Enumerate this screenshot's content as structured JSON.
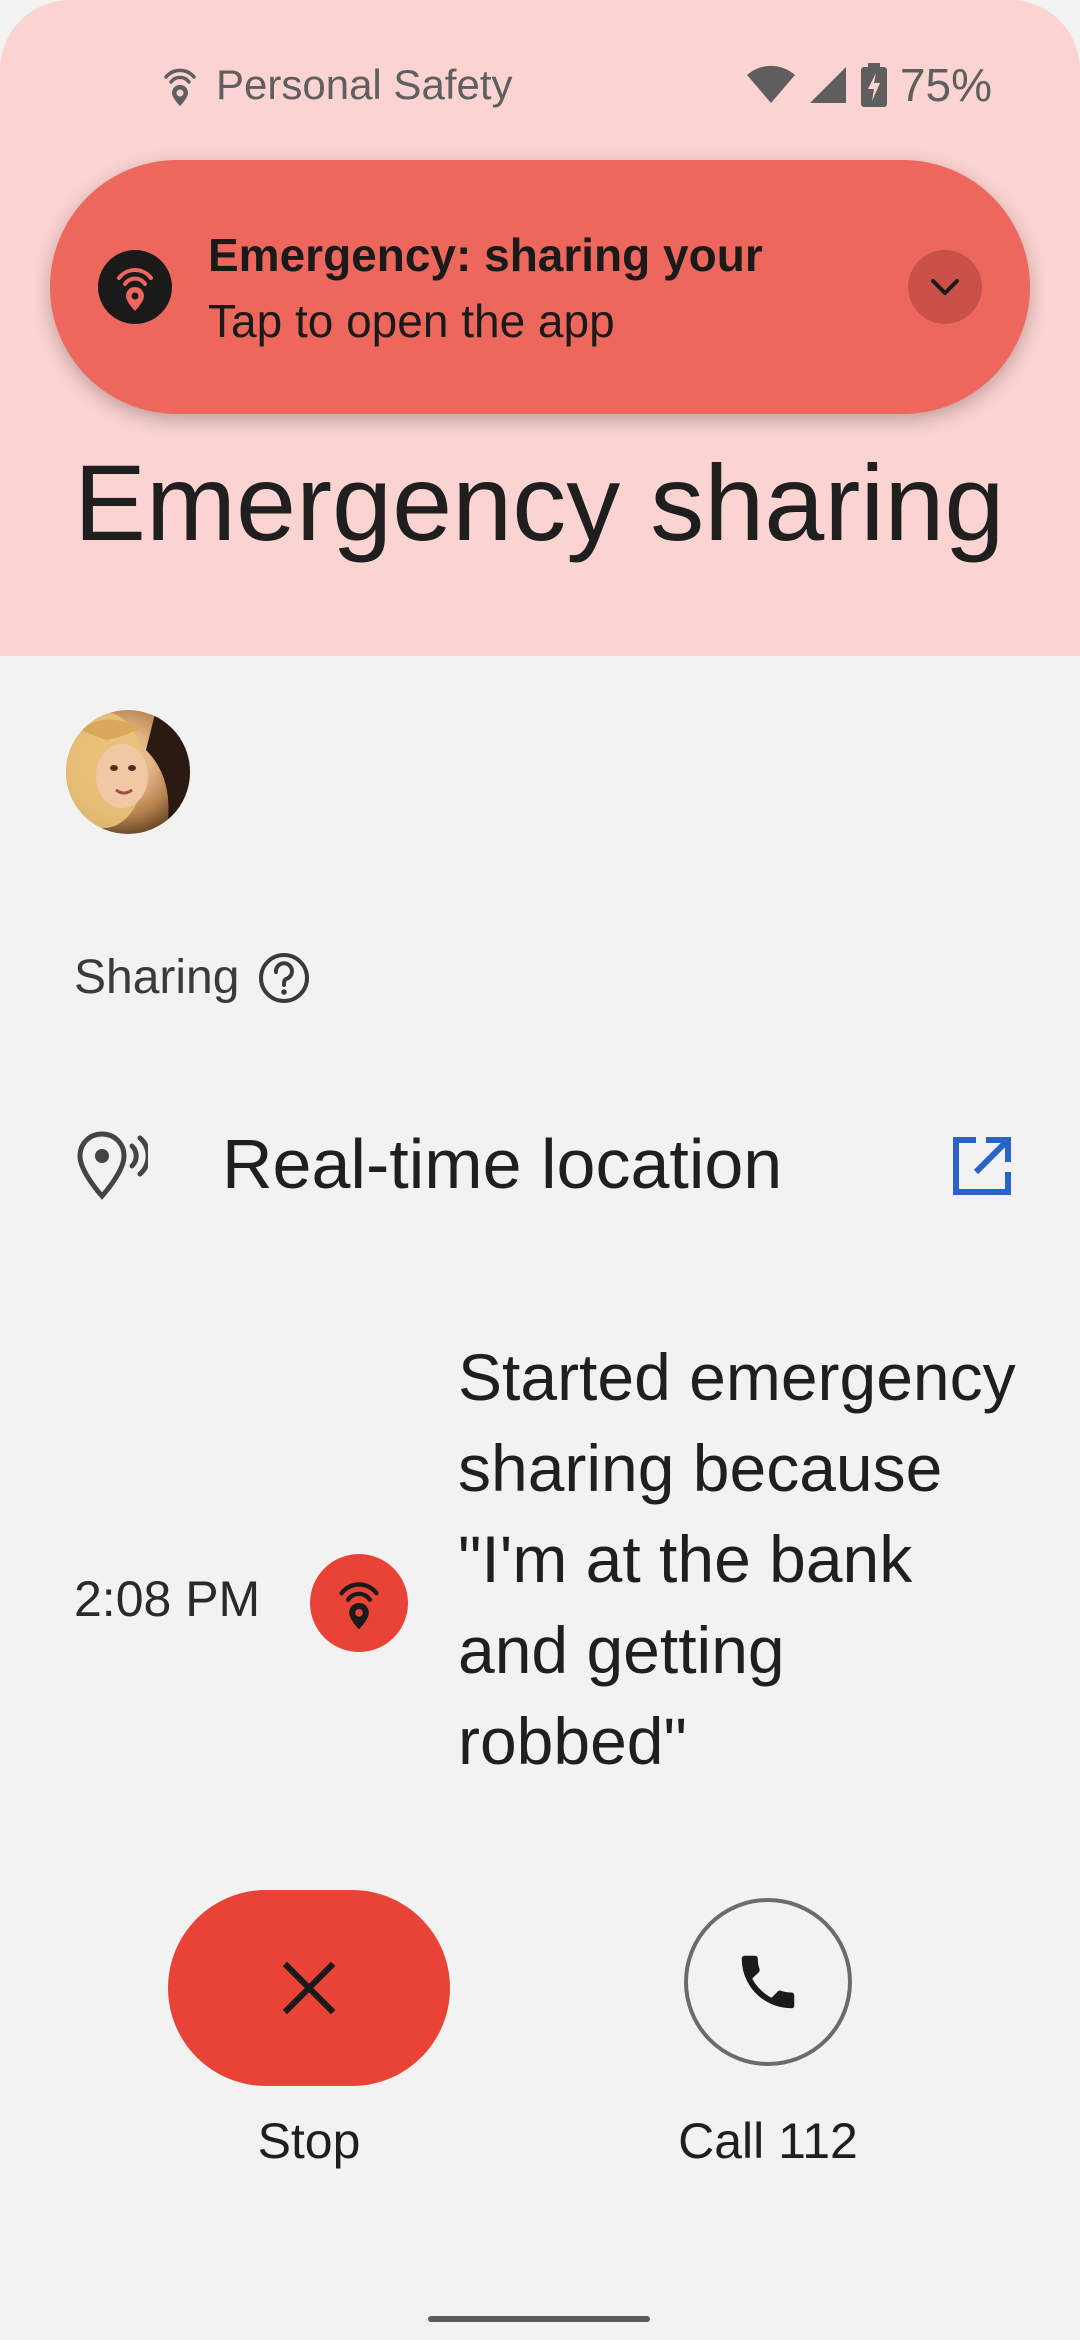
{
  "status_bar": {
    "app_name": "Personal Safety",
    "battery": "75%",
    "icons": [
      "personal-safety-icon",
      "wifi-icon",
      "signal-icon",
      "battery-charging-icon"
    ]
  },
  "notification": {
    "title": "Emergency: sharing your",
    "subtitle": "Tap to open the app",
    "icon": "emergency-sharing-icon",
    "expand_icon": "chevron-down-icon",
    "background": "#ed675c"
  },
  "header": {
    "title": "Emergency sharing",
    "background": "#fbd3d1"
  },
  "sharing": {
    "label": "Sharing",
    "help_icon": "help-icon"
  },
  "location": {
    "label": "Real-time location",
    "icon": "location-pin-icon",
    "link_icon": "open-in-new-icon",
    "link_color": "#2a63c8"
  },
  "timeline": {
    "time": "2:08 PM",
    "text": "Started emergency sharing because \"I'm at the bank and getting robbed\"",
    "icon": "emergency-sharing-icon",
    "accent": "#e94337"
  },
  "actions": {
    "stop_label": "Stop",
    "stop_icon": "close-icon",
    "call_label": "Call 112",
    "call_icon": "phone-icon"
  }
}
